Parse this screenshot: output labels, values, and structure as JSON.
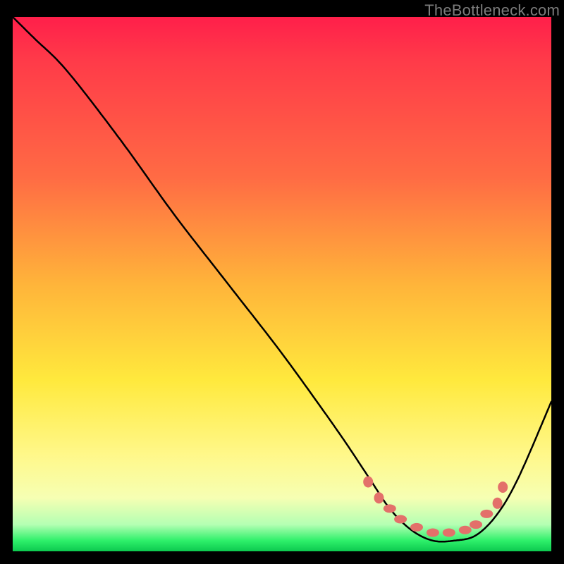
{
  "watermark": "TheBottleneck.com",
  "chart_data": {
    "type": "line",
    "title": "",
    "xlabel": "",
    "ylabel": "",
    "xlim": [
      0,
      100
    ],
    "ylim": [
      0,
      100
    ],
    "series": [
      {
        "name": "bottleneck-curve",
        "x": [
          0,
          4,
          10,
          20,
          30,
          40,
          50,
          60,
          66,
          70,
          74,
          78,
          82,
          86,
          90,
          94,
          100
        ],
        "y": [
          100,
          96,
          90,
          77,
          63,
          50,
          37,
          23,
          14,
          8,
          4,
          2,
          2,
          3,
          7,
          14,
          28
        ]
      }
    ],
    "markers": {
      "name": "highlight-dots",
      "x": [
        66,
        68,
        70,
        72,
        75,
        78,
        81,
        84,
        86,
        88,
        90,
        91
      ],
      "y": [
        13,
        10,
        8,
        6,
        4.5,
        3.5,
        3.5,
        4,
        5,
        7,
        9,
        12
      ]
    },
    "gradient_stops": [
      {
        "pos": 0,
        "color": "#ff1f4a"
      },
      {
        "pos": 30,
        "color": "#ff6b44"
      },
      {
        "pos": 50,
        "color": "#ffb43a"
      },
      {
        "pos": 68,
        "color": "#ffe93d"
      },
      {
        "pos": 90,
        "color": "#f6ffb3"
      },
      {
        "pos": 100,
        "color": "#0cc94f"
      }
    ]
  }
}
